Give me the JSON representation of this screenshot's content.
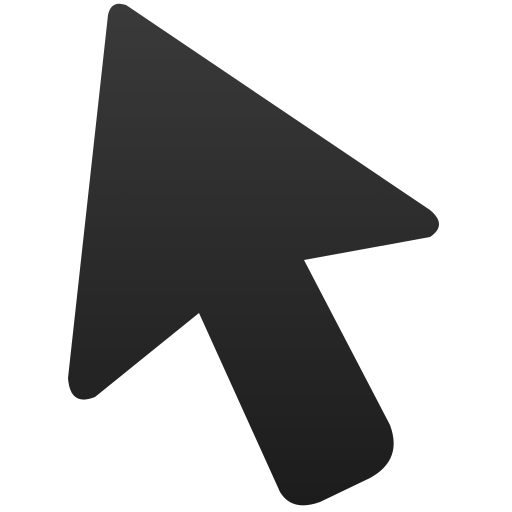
{
  "icon": {
    "name": "mouse-pointer-icon",
    "colors": {
      "fill_top": "#3a3a3a",
      "fill_bottom": "#1c1c1c",
      "background": "#ffffff"
    }
  }
}
